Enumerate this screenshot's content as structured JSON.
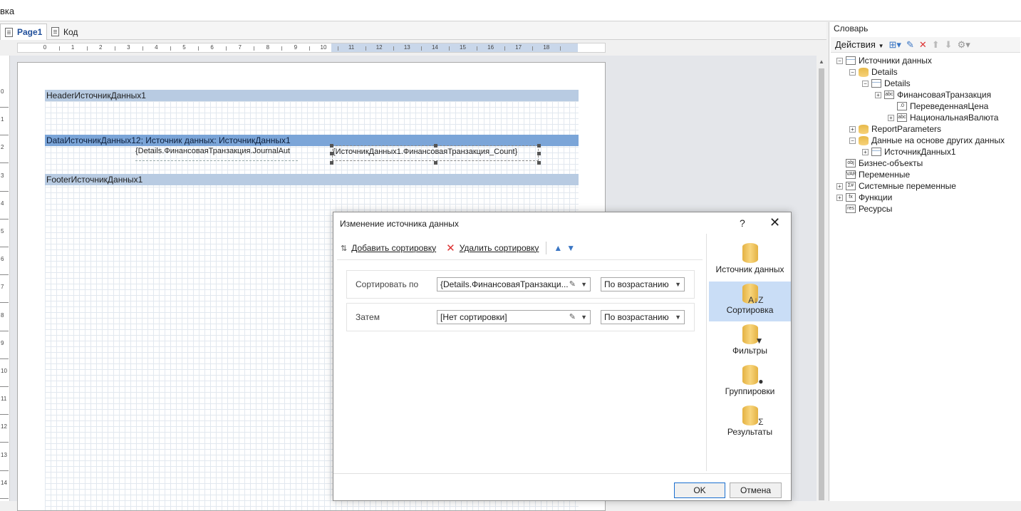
{
  "topbar": {
    "title_fragment": "вка"
  },
  "tabs": [
    {
      "label": "Page1"
    },
    {
      "label": "Код"
    }
  ],
  "ruler": [
    "0",
    "1",
    "2",
    "3",
    "4",
    "5",
    "6",
    "7",
    "8",
    "9",
    "10",
    "11",
    "12",
    "13",
    "14",
    "15",
    "16",
    "17",
    "18"
  ],
  "vruler": [
    "0",
    "1",
    "2",
    "3",
    "4",
    "5",
    "6",
    "7",
    "8",
    "9",
    "10",
    "11",
    "12",
    "13",
    "14"
  ],
  "bands": {
    "header": "HeaderИсточникДанных1",
    "data": "DataИсточникДанных12; Источник данных: ИсточникДанных1",
    "footer": "FooterИсточникДанных1",
    "field1": "{Details.ФинансоваяТранзакция.JournalAut",
    "field2": "{ИсточникДанных1.ФинансоваяТранзакция_Count}"
  },
  "dictionary": {
    "title": "Словарь",
    "actions": "Действия",
    "tree": [
      {
        "label": "Источники данных",
        "exp": "−",
        "icon": "tbl"
      },
      {
        "label": "Details",
        "exp": "−",
        "icon": "db"
      },
      {
        "label": "Details",
        "exp": "−",
        "icon": "tbl"
      },
      {
        "label": "ФинансоваяТранзакция",
        "exp": "+",
        "icon": "abc"
      },
      {
        "label": "ПереведеннаяЦена",
        "exp": "",
        "icon": ".0"
      },
      {
        "label": "НациональнаяВалюта",
        "exp": "+",
        "icon": "abc"
      },
      {
        "label": "ReportParameters",
        "exp": "+",
        "icon": "db"
      },
      {
        "label": "Данные на основе других данных",
        "exp": "−",
        "icon": "db"
      },
      {
        "label": "ИсточникДанных1",
        "exp": "+",
        "icon": "tbl"
      },
      {
        "label": "Бизнес-объекты",
        "exp": "",
        "icon": "obj"
      },
      {
        "label": "Переменные",
        "exp": "",
        "icon": "VAR"
      },
      {
        "label": "Системные переменные",
        "exp": "+",
        "icon": "Σ#"
      },
      {
        "label": "Функции",
        "exp": "+",
        "icon": "fx"
      },
      {
        "label": "Ресурсы",
        "exp": "",
        "icon": "res"
      }
    ]
  },
  "dialog": {
    "title": "Изменение источника данных",
    "help": "?",
    "close": "✕",
    "add_sort": "Добавить сортировку",
    "remove_sort": "Удалить сортировку",
    "rows": [
      {
        "label": "Сортировать по",
        "field": "{Details.ФинансоваяТранзакци...",
        "order": "По возрастанию"
      },
      {
        "label": "Затем",
        "field": "[Нет сортировки]",
        "order": "По возрастанию"
      }
    ],
    "panel": [
      {
        "label": "Источник данных",
        "badge": ""
      },
      {
        "label": "Сортировка",
        "badge": "A↓Z"
      },
      {
        "label": "Фильтры",
        "badge": "▼"
      },
      {
        "label": "Группировки",
        "badge": "●"
      },
      {
        "label": "Результаты",
        "badge": "Σ"
      }
    ],
    "ok": "OK",
    "cancel": "Отмена"
  }
}
